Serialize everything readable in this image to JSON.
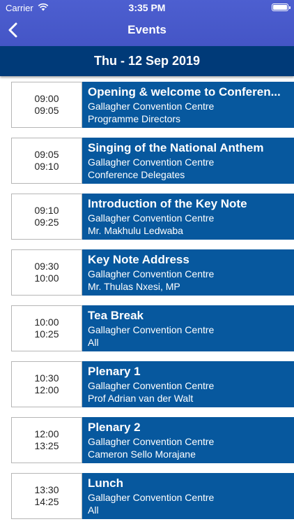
{
  "status_bar": {
    "carrier": "Carrier",
    "time": "3:35 PM"
  },
  "nav": {
    "title": "Events"
  },
  "date_header": "Thu - 12 Sep 2019",
  "events": [
    {
      "start": "09:00",
      "end": "09:05",
      "title": "Opening & welcome to Conferen...",
      "venue": "Gallagher Convention Centre",
      "presenter": "Programme Directors"
    },
    {
      "start": "09:05",
      "end": "09:10",
      "title": "Singing of the National Anthem",
      "venue": "Gallagher Convention Centre",
      "presenter": "Conference Delegates"
    },
    {
      "start": "09:10",
      "end": "09:25",
      "title": "Introduction of the Key Note",
      "venue": "Gallagher Convention Centre",
      "presenter": "Mr. Makhulu Ledwaba"
    },
    {
      "start": "09:30",
      "end": "10:00",
      "title": "Key Note Address",
      "venue": "Gallagher Convention Centre",
      "presenter": "Mr. Thulas Nxesi, MP"
    },
    {
      "start": "10:00",
      "end": "10:25",
      "title": "Tea Break",
      "venue": "Gallagher Convention Centre",
      "presenter": "All"
    },
    {
      "start": "10:30",
      "end": "12:00",
      "title": "Plenary 1",
      "venue": "Gallagher Convention Centre",
      "presenter": "Prof Adrian van der Walt"
    },
    {
      "start": "12:00",
      "end": "13:25",
      "title": "Plenary 2",
      "venue": "Gallagher Convention Centre",
      "presenter": "Cameron Sello Morajane"
    },
    {
      "start": "13:30",
      "end": "14:25",
      "title": "Lunch",
      "venue": "Gallagher Convention Centre",
      "presenter": "All"
    }
  ]
}
